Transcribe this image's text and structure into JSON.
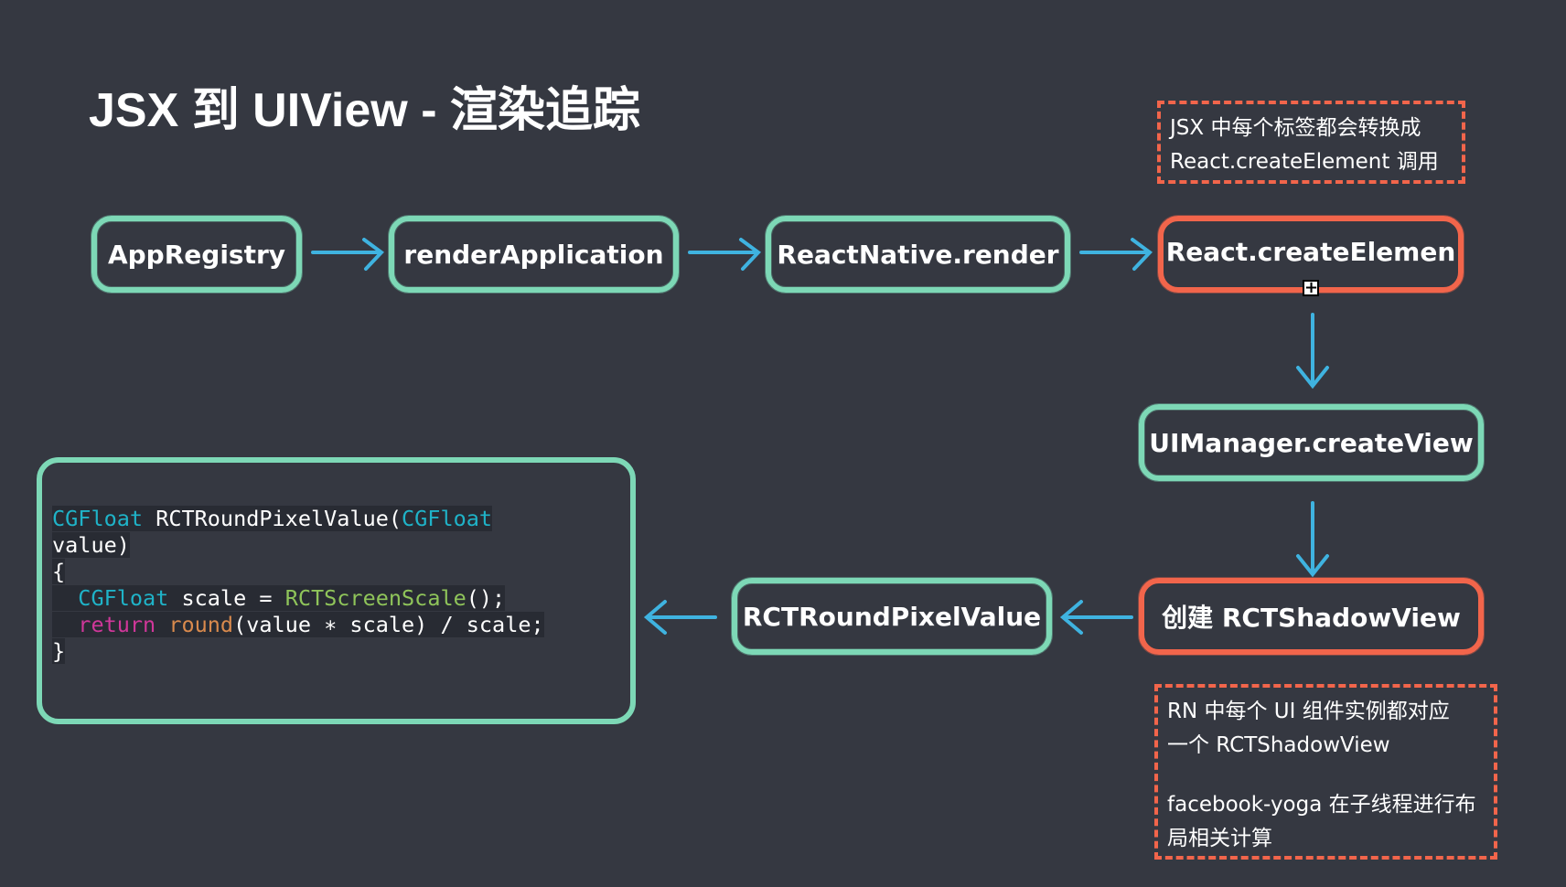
{
  "title": "JSX 到 UIView - 渲染追踪",
  "nodes": {
    "app_registry": "AppRegistry",
    "render_application": "renderApplication",
    "react_native_render": "ReactNative.render",
    "create_element": "React.createElemen",
    "ui_manager": "UIManager.createView",
    "shadow_view": "创建 RCTShadowView",
    "round_pixel": "RCTRoundPixelValue"
  },
  "notes": {
    "top": [
      "JSX 中每个标签都会转换成",
      "React.createElement 调用"
    ],
    "bottom": [
      "RN 中每个 UI 组件实例都对应",
      "一个 RCTShadowView",
      "facebook-yoga 在子线程进行布",
      "局相关计算"
    ]
  },
  "code": {
    "l1a": "CGFloat",
    "l1b": " RCTRoundPixelValue(",
    "l1c": "CGFloat",
    "l2": "value)",
    "l3": "{",
    "l4a": "  ",
    "l4b": "CGFloat",
    "l4c": " scale = ",
    "l4d": "RCTScreenScale",
    "l4e": "();",
    "l5a": "  ",
    "l5b": "return",
    "l5c": " ",
    "l5d": "round",
    "l5e": "(value ∗ scale) / scale;",
    "l6": "}"
  },
  "colors": {
    "box": "#7dd8b6",
    "highlight": "#f2654b",
    "arrow": "#3fb3e0",
    "background": "#353841"
  }
}
